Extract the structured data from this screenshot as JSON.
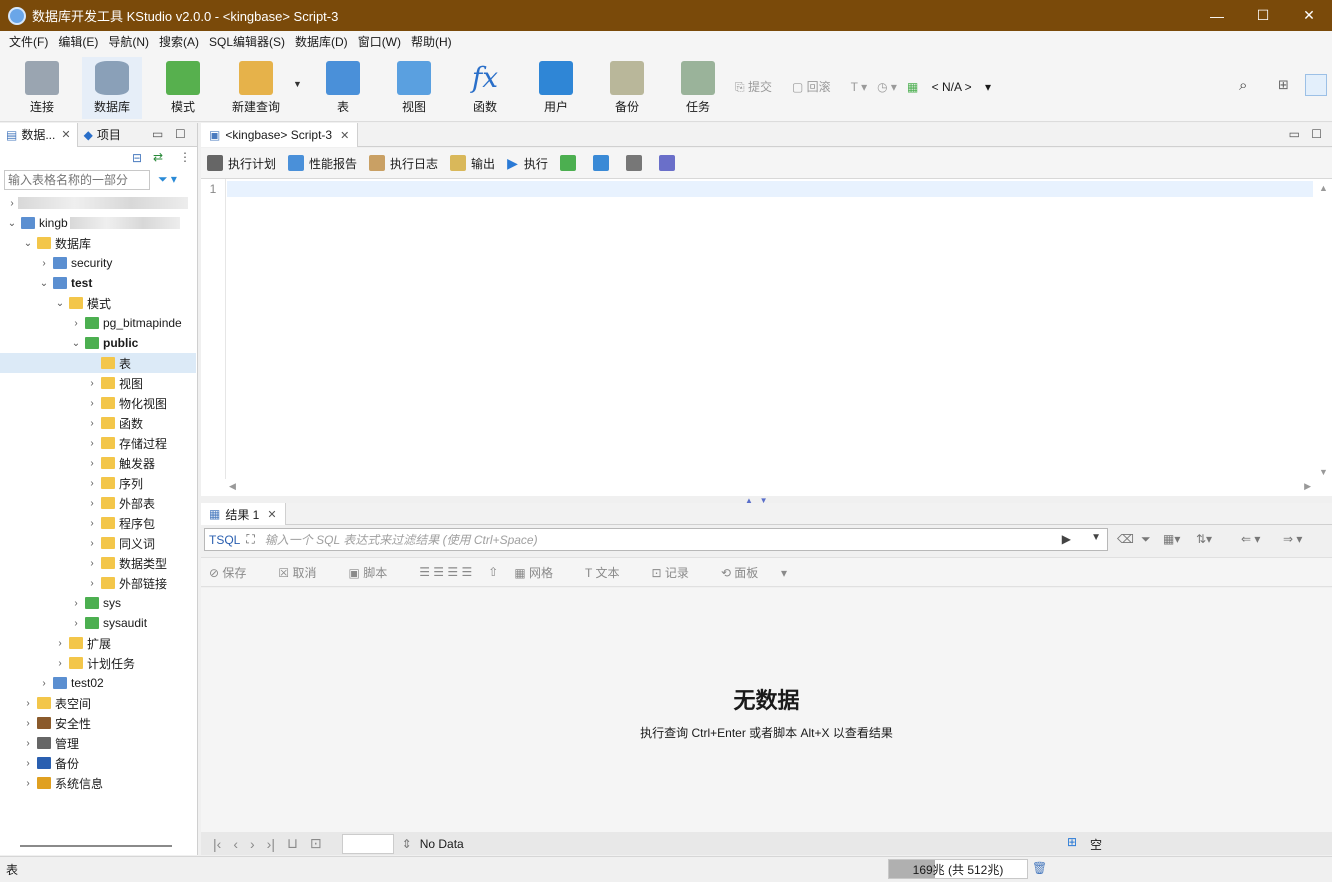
{
  "window": {
    "title": "数据库开发工具 KStudio v2.0.0 - <kingbase> Script-3",
    "minimize": "—",
    "maximize": "☐",
    "close": "✕"
  },
  "menu": [
    "文件(F)",
    "编辑(E)",
    "导航(N)",
    "搜索(A)",
    "SQL编辑器(S)",
    "数据库(D)",
    "窗口(W)",
    "帮助(H)"
  ],
  "toolbar": {
    "buttons": [
      "连接",
      "数据库",
      "模式",
      "新建查询",
      "表",
      "视图",
      "函数",
      "用户",
      "备份",
      "任务"
    ],
    "commit": "提交",
    "rollback": "回滚",
    "active_schema": "< N/A >"
  },
  "left_panel": {
    "tab_db": "数据...",
    "tab_project": "项目",
    "filter_placeholder": "输入表格名称的一部分",
    "tree": {
      "conn_label": "kingb",
      "databases": "数据库",
      "security_db": "security",
      "test_db": "test",
      "schemas": "模式",
      "pg_bitmap": "pg_bitmapinde",
      "public": "public",
      "tables": "表",
      "views": "视图",
      "matviews": "物化视图",
      "functions": "函数",
      "procedures": "存储过程",
      "triggers": "触发器",
      "sequences": "序列",
      "foreign_tables": "外部表",
      "packages": "程序包",
      "synonyms": "同义词",
      "datatypes": "数据类型",
      "dblinks": "外部链接",
      "sys": "sys",
      "sysaudit": "sysaudit",
      "extensions": "扩展",
      "jobs": "计划任务",
      "test02": "test02",
      "tablespaces": "表空间",
      "security": "安全性",
      "management": "管理",
      "backup": "备份",
      "sysinfo": "系统信息"
    }
  },
  "editor": {
    "tab": "<kingbase> Script-3",
    "actions": [
      "执行计划",
      "性能报告",
      "执行日志",
      "输出",
      "执行"
    ],
    "line_number": "1"
  },
  "results": {
    "tab": "结果 1",
    "sql_label": "SQL",
    "filter_placeholder": "输入一个 SQL 表达式来过滤结果 (使用 Ctrl+Space)",
    "actions": [
      "保存",
      "取消",
      "脚本",
      "网格",
      "文本",
      "记录",
      "面板"
    ],
    "empty_title": "无数据",
    "empty_hint": "执行查询 Ctrl+Enter 或者脚本 Alt+X 以查看结果",
    "status": "No Data",
    "right_label": "空"
  },
  "statusbar": {
    "left": "表",
    "memory": "169兆 (共 512兆)",
    "memory_used_fraction": 0.33
  },
  "colors": {
    "titlebar": "#7a4a0a",
    "selection": "#dceaf7",
    "current_line": "#e8f2fe"
  }
}
